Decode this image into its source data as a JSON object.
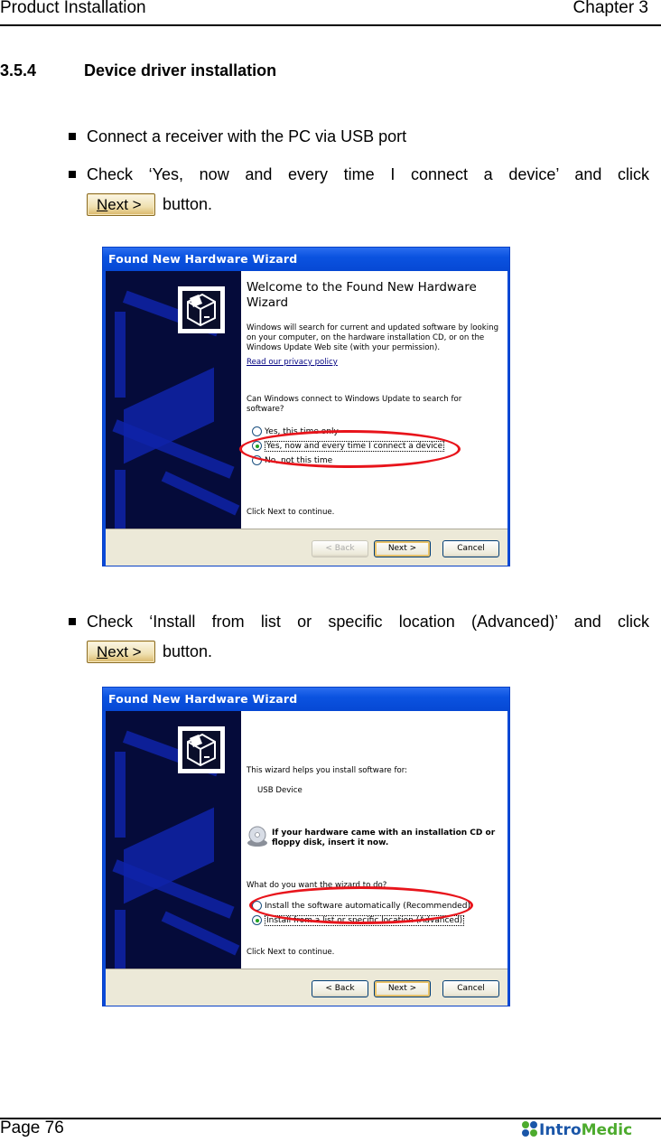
{
  "header": {
    "left": "Product Installation",
    "right": "Chapter 3"
  },
  "section": {
    "number": "3.5.4",
    "title": "Device driver installation"
  },
  "steps": [
    {
      "text": "Connect a receiver with the PC via USB port"
    },
    {
      "text": "Check ‘Yes, now and every time I connect a device’ and click",
      "button_label": "Next >",
      "button_suffix": "button."
    },
    {
      "text": "Check ‘Install from list or specific location (Advanced)’ and click",
      "button_label": "Next >",
      "button_suffix": "button."
    }
  ],
  "wizard1": {
    "title": "Found New Hardware Wizard",
    "heading": "Welcome to the Found New Hardware Wizard",
    "intro": "Windows will search for current and updated software by looking on your computer, on the hardware installation CD, or on the Windows Update Web site (with your permission).",
    "privacy_link": "Read our privacy policy",
    "question": "Can Windows connect to Windows Update to search for software?",
    "options": [
      {
        "label": "Yes, this time only",
        "selected": false
      },
      {
        "label": "Yes, now and every time I connect a device",
        "selected": true
      },
      {
        "label": "No, not this time",
        "selected": false
      }
    ],
    "continue_text": "Click Next to continue.",
    "buttons": {
      "back": "< Back",
      "next": "Next >",
      "cancel": "Cancel"
    }
  },
  "wizard2": {
    "title": "Found New Hardware Wizard",
    "intro": "This wizard helps you install software for:",
    "device": "USB Device",
    "cd_notice": "If your hardware came with an installation CD or floppy disk, insert it now.",
    "question": "What do you want the wizard to do?",
    "options": [
      {
        "label": "Install the software automatically (Recommended)",
        "selected": false
      },
      {
        "label": "Install from a list or specific location (Advanced)",
        "selected": true
      }
    ],
    "continue_text": "Click Next to continue.",
    "buttons": {
      "back": "< Back",
      "next": "Next >",
      "cancel": "Cancel"
    }
  },
  "footer": {
    "page": "Page 76",
    "logo_part1": "Intro",
    "logo_part2": "Medic"
  },
  "colors": {
    "highlight_ellipse": "#e8141b",
    "xp_title_blue": "#0b53e0",
    "logo_blue": "#1a56a8",
    "logo_green": "#4dab2e"
  }
}
